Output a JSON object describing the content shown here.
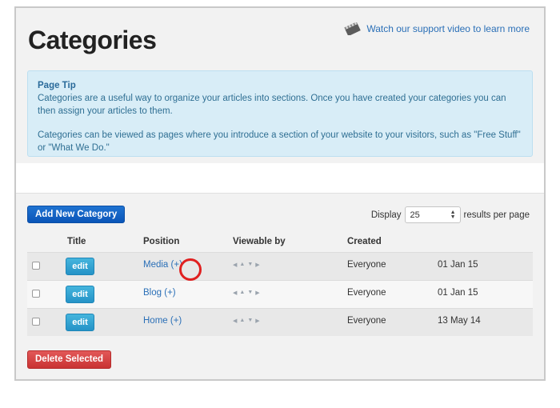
{
  "page": {
    "title": "Categories",
    "support_link": "Watch our support video to learn more"
  },
  "tip": {
    "title": "Page Tip",
    "paragraph1": "Categories are a useful way to organize your articles into sections. Once you have created your categories you can then assign your articles to them.",
    "paragraph2": "Categories can be viewed as pages where you introduce a section of your website to your visitors, such as \"Free Stuff\" or \"What We Do.\""
  },
  "toolbar": {
    "add_label": "Add New Category",
    "display_label": "Display",
    "display_value": "25",
    "results_label": "results per page"
  },
  "table": {
    "columns": [
      "Title",
      "Position",
      "Viewable by",
      "Created"
    ],
    "rows": [
      {
        "edit": "edit",
        "title": "Media",
        "plus": "(+)",
        "viewable": "Everyone",
        "created": "01 Jan 15"
      },
      {
        "edit": "edit",
        "title": "Blog",
        "plus": "(+)",
        "viewable": "Everyone",
        "created": "01 Jan 15"
      },
      {
        "edit": "edit",
        "title": "Home",
        "plus": "(+)",
        "viewable": "Everyone",
        "created": "13 May 14"
      }
    ]
  },
  "footer": {
    "delete_label": "Delete Selected"
  },
  "colors": {
    "link": "#2a6fb7",
    "add_button": "#0a55b8",
    "edit_button": "#2593c7",
    "delete_button": "#c93333",
    "highlight": "#e02020"
  },
  "icons": {
    "support": "video-clapper-icon",
    "position": [
      "arrow-left-icon",
      "arrow-up-icon",
      "arrow-down-icon",
      "arrow-right-icon"
    ]
  }
}
